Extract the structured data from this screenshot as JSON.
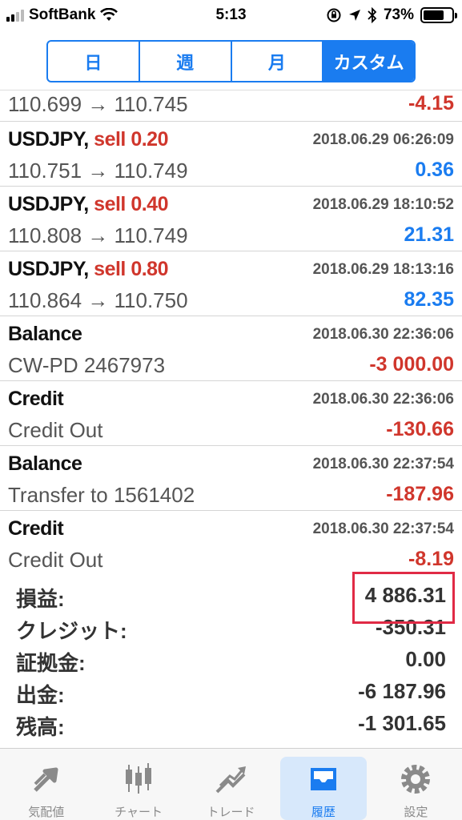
{
  "status_bar": {
    "carrier": "SoftBank",
    "time": "5:13",
    "battery_percent": "73%",
    "battery_level": 0.73
  },
  "segmented": [
    "日",
    "週",
    "月",
    "カスタム"
  ],
  "segmented_active_index": 3,
  "history": [
    {
      "desc": "110.699 → 110.745",
      "amount": "-4.15",
      "sign": "neg",
      "partial": true
    },
    {
      "symbol": "USDJPY,",
      "side": "sell 0.20",
      "date": "2018.06.29 06:26:09",
      "desc": "110.751 → 110.749",
      "amount": "0.36",
      "sign": "pos"
    },
    {
      "symbol": "USDJPY,",
      "side": "sell 0.40",
      "date": "2018.06.29 18:10:52",
      "desc": "110.808 → 110.749",
      "amount": "21.31",
      "sign": "pos"
    },
    {
      "symbol": "USDJPY,",
      "side": "sell 0.80",
      "date": "2018.06.29 18:13:16",
      "desc": "110.864 → 110.750",
      "amount": "82.35",
      "sign": "pos"
    },
    {
      "symbol": "Balance",
      "side": "",
      "date": "2018.06.30 22:36:06",
      "desc": "CW-PD 2467973",
      "amount": "-3 000.00",
      "sign": "neg"
    },
    {
      "symbol": "Credit",
      "side": "",
      "date": "2018.06.30 22:36:06",
      "desc": "Credit Out",
      "amount": "-130.66",
      "sign": "neg"
    },
    {
      "symbol": "Balance",
      "side": "",
      "date": "2018.06.30 22:37:54",
      "desc": "Transfer to 1561402",
      "amount": "-187.96",
      "sign": "neg"
    },
    {
      "symbol": "Credit",
      "side": "",
      "date": "2018.06.30 22:37:54",
      "desc": "Credit Out",
      "amount": "-8.19",
      "sign": "neg"
    }
  ],
  "summary": [
    {
      "label": "損益:",
      "value": "4 886.31"
    },
    {
      "label": "クレジット:",
      "value": "-350.31"
    },
    {
      "label": "証拠金:",
      "value": "0.00"
    },
    {
      "label": "出金:",
      "value": "-6 187.96"
    },
    {
      "label": "残高:",
      "value": "-1 301.65"
    }
  ],
  "tabs": [
    {
      "label": "気配値",
      "icon": "quotes-icon"
    },
    {
      "label": "チャート",
      "icon": "chart-icon"
    },
    {
      "label": "トレード",
      "icon": "trade-icon"
    },
    {
      "label": "履歴",
      "icon": "history-icon"
    },
    {
      "label": "設定",
      "icon": "settings-icon"
    }
  ],
  "active_tab_index": 3,
  "colors": {
    "accent": "#1a7cf0",
    "negative": "#d0362c",
    "highlight": "#e02a45"
  }
}
